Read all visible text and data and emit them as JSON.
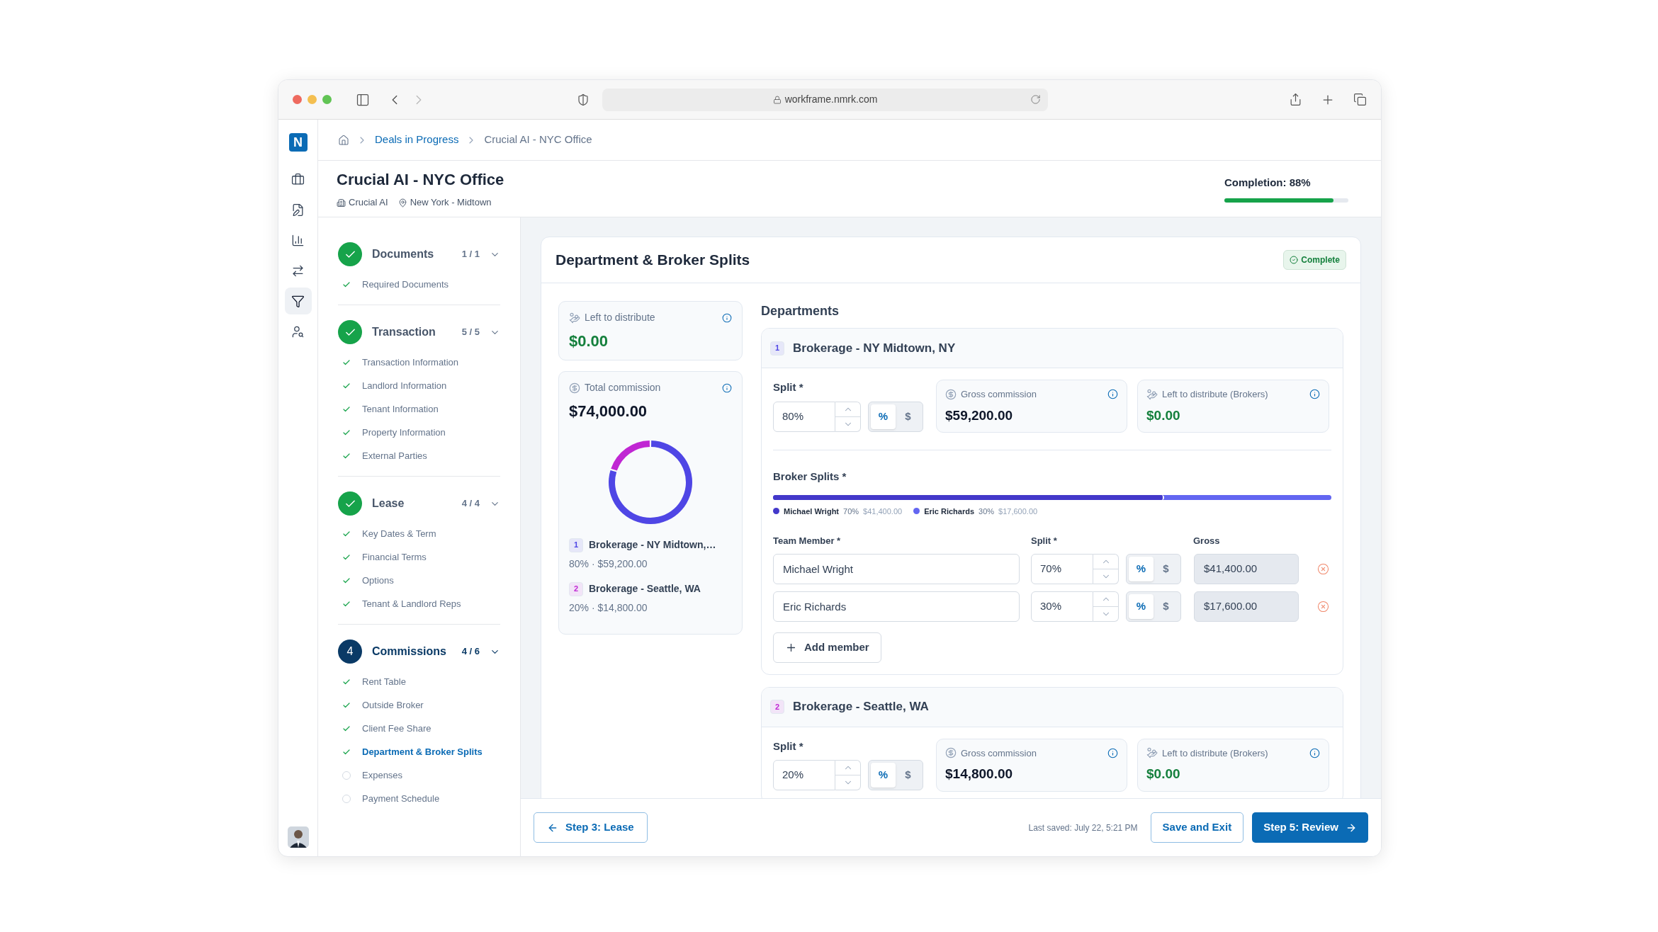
{
  "browser": {
    "url": "workframe.nmrk.com"
  },
  "logo": "N",
  "rail": [
    {
      "kind": "briefcase",
      "selected": false
    },
    {
      "kind": "document",
      "selected": false
    },
    {
      "kind": "chart",
      "selected": false
    },
    {
      "kind": "transfer",
      "selected": false
    },
    {
      "kind": "filter",
      "selected": true
    },
    {
      "kind": "people",
      "selected": false
    }
  ],
  "breadcrumb": [
    "Deals in Progress",
    "Crucial AI - NYC Office"
  ],
  "deal": {
    "title": "Crucial AI - NYC Office",
    "company": "Crucial AI",
    "location": "New York - Midtown",
    "completion": "Completion: 88%",
    "level": 0.88
  },
  "steps": [
    {
      "title": "Documents",
      "count": "1 / 1",
      "done": true,
      "items": [
        {
          "label": "Required Documents",
          "done": true,
          "selected": false
        }
      ]
    },
    {
      "title": "Transaction",
      "count": "5 / 5",
      "done": true,
      "items": [
        {
          "label": "Transaction Information",
          "done": true,
          "selected": false
        },
        {
          "label": "Landlord Information",
          "done": true,
          "selected": false
        },
        {
          "label": "Tenant Information",
          "done": true,
          "selected": false
        },
        {
          "label": "Property Information",
          "done": true,
          "selected": false
        },
        {
          "label": "External Parties",
          "done": true,
          "selected": false
        }
      ]
    },
    {
      "title": "Lease",
      "count": "4 / 4",
      "done": true,
      "items": [
        {
          "label": "Key Dates & Term",
          "done": true,
          "selected": false
        },
        {
          "label": "Financial Terms",
          "done": true,
          "selected": false
        },
        {
          "label": "Options",
          "done": true,
          "selected": false
        },
        {
          "label": "Tenant & Landlord Reps",
          "done": true,
          "selected": false
        }
      ]
    },
    {
      "title": "Commissions",
      "count": "4 / 6",
      "done": false,
      "number": "4",
      "items": [
        {
          "label": "Rent Table",
          "done": true,
          "selected": false
        },
        {
          "label": "Outside Broker",
          "done": true,
          "selected": false
        },
        {
          "label": "Client Fee Share",
          "done": true,
          "selected": false
        },
        {
          "label": "Department & Broker Splits",
          "done": true,
          "selected": true
        },
        {
          "label": "Expenses",
          "done": false,
          "selected": false
        },
        {
          "label": "Payment Schedule",
          "done": false,
          "selected": false
        }
      ]
    }
  ],
  "section": {
    "title": "Department & Broker Splits",
    "status": "Complete"
  },
  "summary": {
    "left_label": "Left to distribute",
    "left_value": "$0.00",
    "total_label": "Total commission",
    "total_value": "$74,000.00",
    "chart_data": {
      "type": "donut",
      "values": [
        80,
        20
      ]
    },
    "departments": [
      {
        "index": "1",
        "name": "Brokerage - NY Midtown,…",
        "detail": "80% · $59,200.00",
        "color": "#4f46e5"
      },
      {
        "index": "2",
        "name": "Brokerage - Seattle, WA",
        "detail": "20% · $14,800.00",
        "color": "#c026d3"
      }
    ]
  },
  "departments_title": "Departments",
  "departments": [
    {
      "index": "1",
      "name": "Brokerage - NY Midtown, NY",
      "color": "#4f46e5",
      "split_label": "Split *",
      "split": "80%",
      "units": [
        {
          "label": "%",
          "selected": true
        },
        {
          "label": "$",
          "selected": false
        }
      ],
      "gross_label": "Gross commission",
      "gross": "$59,200.00",
      "left_label": "Left to distribute (Brokers)",
      "left": "$0.00",
      "brokers_title": "Broker Splits *",
      "columns": [
        "Team Member *",
        "Split *",
        "Gross"
      ],
      "brokers": [
        {
          "legend_name": "Michael Wright",
          "legend_split": "70%",
          "legend_gross": "$41,400.00",
          "name": "Michael Wright",
          "split": "70%",
          "gross": "$41,400.00",
          "level": 0.7,
          "color": "#4338ca",
          "units": [
            {
              "label": "%",
              "selected": true
            },
            {
              "label": "$",
              "selected": false
            }
          ]
        },
        {
          "legend_name": "Eric Richards",
          "legend_split": "30%",
          "legend_gross": "$17,600.00",
          "name": "Eric Richards",
          "split": "30%",
          "gross": "$17,600.00",
          "color": "#6366f1",
          "units": [
            {
              "label": "%",
              "selected": true
            },
            {
              "label": "$",
              "selected": false
            }
          ]
        }
      ],
      "add_label": "Add member"
    },
    {
      "index": "2",
      "name": "Brokerage - Seattle, WA",
      "color": "#c026d3",
      "split_label": "Split *",
      "split": "20%",
      "units": [
        {
          "label": "%",
          "selected": true
        },
        {
          "label": "$",
          "selected": false
        }
      ],
      "gross_label": "Gross commission",
      "gross": "$14,800.00",
      "left_label": "Left to distribute (Brokers)",
      "left": "$0.00"
    }
  ],
  "footer": {
    "back": "Step 3: Lease",
    "saved": "Last saved: July 22, 5:21 PM",
    "save": "Save and Exit",
    "next": "Step 5: Review"
  }
}
